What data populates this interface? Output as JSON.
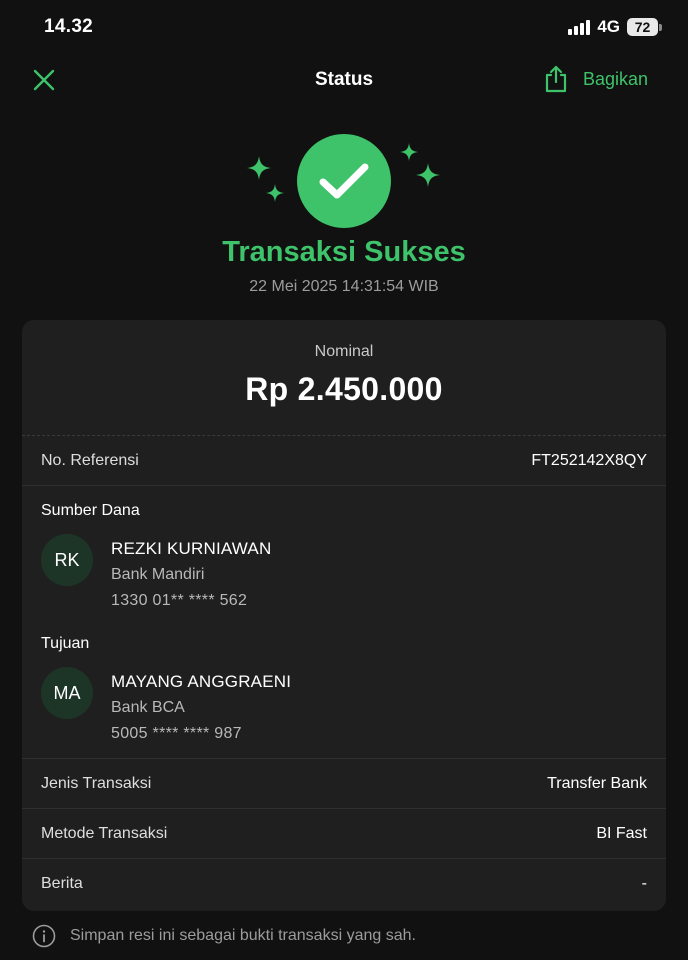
{
  "status_bar": {
    "time": "14.32",
    "network": "4G",
    "battery": "72"
  },
  "nav": {
    "title": "Status",
    "share_label": "Bagikan"
  },
  "result": {
    "title": "Transaksi Sukses",
    "datetime": "22 Mei 2025 14:31:54 WIB"
  },
  "receipt": {
    "nominal_label": "Nominal",
    "nominal_value": "Rp 2.450.000",
    "reference_label": "No. Referensi",
    "reference_value": "FT252142X8QY",
    "source": {
      "heading": "Sumber Dana",
      "initials": "RK",
      "name": "REZKI KURNIAWAN",
      "bank": "Bank Mandiri",
      "account": "1330 01** **** 562"
    },
    "destination": {
      "heading": "Tujuan",
      "initials": "MA",
      "name": "MAYANG ANGGRAENI",
      "bank": "Bank BCA",
      "account": "5005 **** **** 987"
    },
    "type_label": "Jenis Transaksi",
    "type_value": "Transfer Bank",
    "method_label": "Metode Transaksi",
    "method_value": "BI Fast",
    "note_label": "Berita",
    "note_value": "-"
  },
  "footer": {
    "note": "Simpan resi ini sebagai bukti transaksi yang sah."
  },
  "colors": {
    "accent": "#3ec26a",
    "background": "#111111",
    "card": "#1f1f1f",
    "avatar_bg": "#1d3527"
  },
  "icons": {
    "close": "close-icon",
    "share": "share-icon",
    "success": "check-icon",
    "info": "info-icon"
  }
}
